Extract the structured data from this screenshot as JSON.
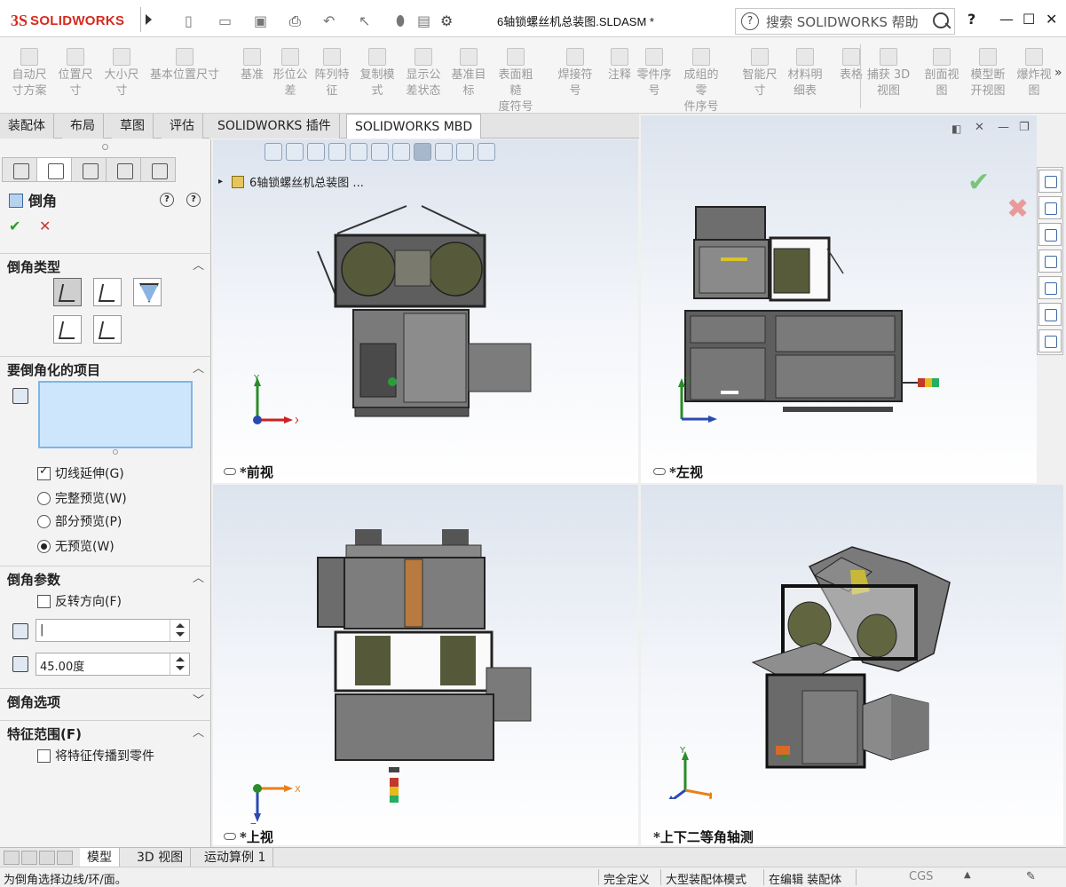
{
  "app": {
    "logo_ds": "3S",
    "logo_text": "SOLIDWORKS",
    "document_title": "6轴锁螺丝机总装图.SLDASM *",
    "search_placeholder": "搜索 SOLIDWORKS 帮助",
    "help_label": "?",
    "minimize": "—",
    "maximize": "☐",
    "close": "✕"
  },
  "commands": [
    {
      "label": "自动尺寸方案",
      "line1": "自动尺",
      "line2": "寸方案"
    },
    {
      "label": "位置尺寸",
      "line1": "位置尺",
      "line2": "寸"
    },
    {
      "label": "大小尺寸",
      "line1": "大小尺",
      "line2": "寸"
    },
    {
      "label": "基本位置尺寸",
      "line1": "基本位置尺寸",
      "line2": ""
    },
    {
      "label": "基准",
      "line1": "基准",
      "line2": ""
    },
    {
      "label": "形位公差",
      "line1": "形位公",
      "line2": "差"
    },
    {
      "label": "阵列特征",
      "line1": "阵列特",
      "line2": "征"
    },
    {
      "label": "复制模式",
      "line1": "复制模",
      "line2": "式"
    },
    {
      "label": "显示公差状态",
      "line1": "显示公",
      "line2": "差状态"
    },
    {
      "label": "基准目标",
      "line1": "基准目",
      "line2": "标"
    },
    {
      "label": "表面粗糙度符号",
      "line1": "表面粗糙",
      "line2": "度符号"
    },
    {
      "label": "焊接符号",
      "line1": "焊接符",
      "line2": "号"
    },
    {
      "label": "注释",
      "line1": "注释",
      "line2": ""
    },
    {
      "label": "零件序号",
      "line1": "零件序",
      "line2": "号"
    },
    {
      "label": "成组的零件序号",
      "line1": "成组的零",
      "line2": "件序号"
    },
    {
      "label": "智能尺寸",
      "line1": "智能尺",
      "line2": "寸"
    },
    {
      "label": "材料明细表",
      "line1": "材料明",
      "line2": "细表"
    },
    {
      "label": "表格",
      "line1": "表格",
      "line2": ""
    },
    {
      "label": "捕获 3D 视图",
      "line1": "捕获 3D",
      "line2": "视图"
    },
    {
      "label": "剖面视图",
      "line1": "剖面视",
      "line2": "图"
    },
    {
      "label": "模型断开视图",
      "line1": "模型断",
      "line2": "开视图"
    },
    {
      "label": "爆炸视图",
      "line1": "爆炸视",
      "line2": "图"
    }
  ],
  "tabs": [
    "装配体",
    "布局",
    "草图",
    "评估",
    "SOLIDWORKS 插件",
    "SOLIDWORKS MBD"
  ],
  "active_tab": "SOLIDWORKS MBD",
  "property_manager": {
    "title": "倒角",
    "sections": {
      "type": "倒角类型",
      "items": "要倒角化的项目",
      "params": "倒角参数",
      "options": "倒角选项",
      "scope": "特征范围(F)"
    },
    "tangent_propagation": "切线延伸(G)",
    "full_preview": "完整预览(W)",
    "partial_preview": "部分预览(P)",
    "no_preview": "无预览(W)",
    "reverse_direction": "反转方向(F)",
    "distance_value": "|",
    "angle_value": "45.00度",
    "propagate_to_parts": "将特征传播到零件"
  },
  "feature_tree_item": "6轴锁螺丝机总装图 ...",
  "viewports": {
    "front": "*前视",
    "left": "*左视",
    "top": "*上视",
    "iso": "*上下二等角轴测"
  },
  "axes": {
    "x": "X",
    "y": "Y",
    "z": "Z"
  },
  "bottom_tabs": [
    "模型",
    "3D 视图",
    "运动算例 1"
  ],
  "status": {
    "message": "为倒角选择边线/环/面。",
    "definition": "完全定义",
    "mode": "大型装配体模式",
    "editing": "在编辑 装配体",
    "units": "CGS"
  }
}
